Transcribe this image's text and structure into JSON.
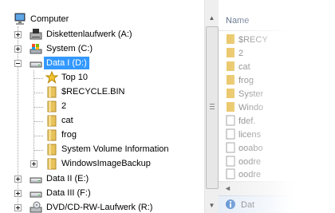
{
  "tree": {
    "items": [
      {
        "label": "Computer",
        "icon": "computer-icon"
      },
      {
        "label": "Diskettenlaufwerk (A:)",
        "icon": "floppy-drive-icon"
      },
      {
        "label": "System (C:)",
        "icon": "system-drive-icon"
      },
      {
        "label": "Data I (D:)",
        "icon": "hard-drive-icon",
        "selected": true
      },
      {
        "label": "Top 10",
        "icon": "star-folder-icon"
      },
      {
        "label": "$RECYCLE.BIN",
        "icon": "folder-icon"
      },
      {
        "label": "2",
        "icon": "folder-icon"
      },
      {
        "label": "cat",
        "icon": "folder-icon"
      },
      {
        "label": "frog",
        "icon": "folder-icon"
      },
      {
        "label": "System Volume Information",
        "icon": "folder-icon"
      },
      {
        "label": "WindowsImageBackup",
        "icon": "folder-icon"
      },
      {
        "label": "Data II (E:)",
        "icon": "hard-drive-icon"
      },
      {
        "label": "Data III (F:)",
        "icon": "hard-drive-icon"
      },
      {
        "label": "DVD/CD-RW-Laufwerk (R:)",
        "icon": "dvd-drive-icon"
      }
    ]
  },
  "scrollbar": {
    "up_glyph": "▲",
    "down_glyph": "▼"
  },
  "file_list": {
    "column_header": "Name",
    "items": [
      {
        "label": "$RECY",
        "icon": "folder-icon"
      },
      {
        "label": "2",
        "icon": "folder-icon"
      },
      {
        "label": "cat",
        "icon": "folder-icon"
      },
      {
        "label": "frog",
        "icon": "folder-icon"
      },
      {
        "label": "Syster",
        "icon": "folder-icon"
      },
      {
        "label": "Windo",
        "icon": "folder-icon"
      },
      {
        "label": "fdef.",
        "icon": "file-icon"
      },
      {
        "label": "licens",
        "icon": "file-icon"
      },
      {
        "label": "ooabo",
        "icon": "file-icon"
      },
      {
        "label": "oodre",
        "icon": "file-icon"
      },
      {
        "label": "oodre",
        "icon": "file-icon"
      }
    ],
    "hscroll_left_glyph": "◄",
    "details_text": "Dat"
  },
  "colors": {
    "selection": "#3399ff",
    "folder": "#e8c25a",
    "header_text": "#4c607a"
  }
}
